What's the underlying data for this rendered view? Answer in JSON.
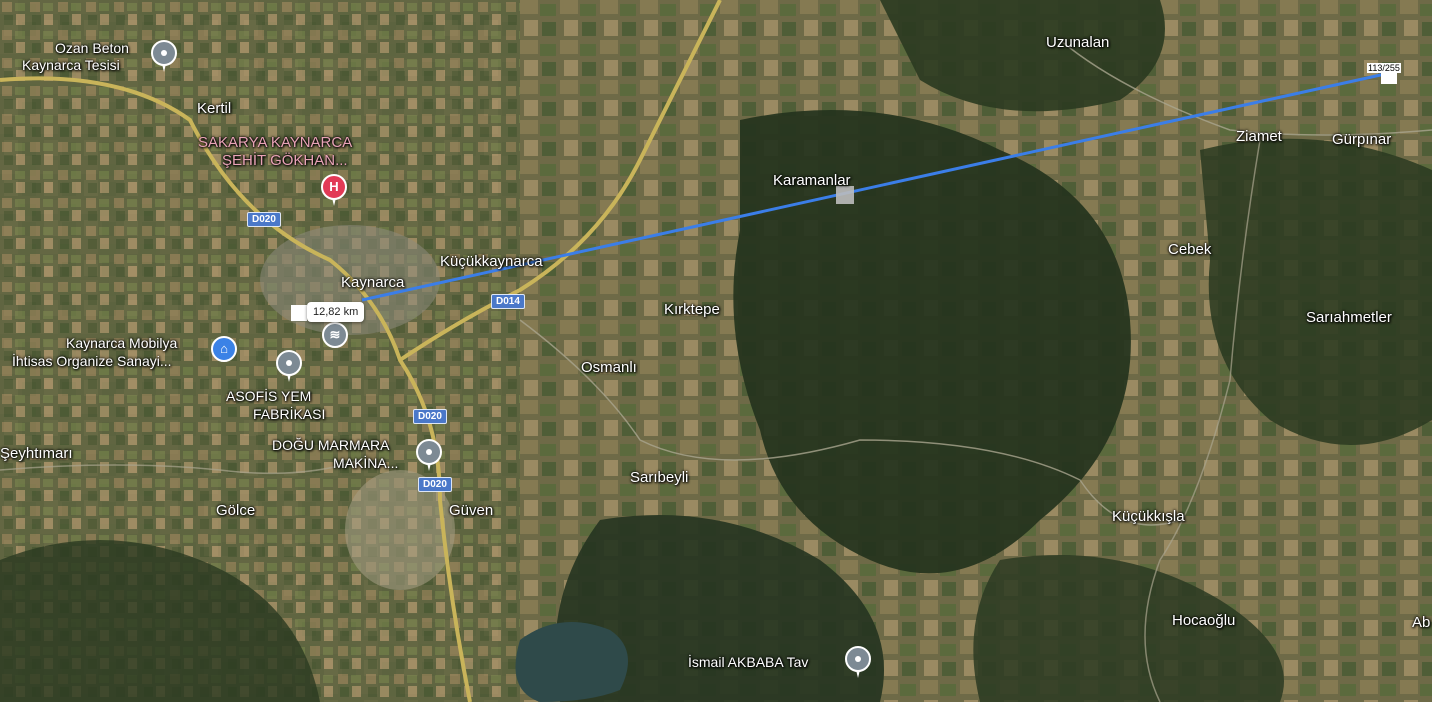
{
  "places": [
    {
      "id": "ozan-beton",
      "text": "Ozan Beton"
    },
    {
      "id": "kaynarca-tesisi",
      "text": "Kaynarca Tesisi"
    },
    {
      "id": "kertil",
      "text": "Kertil"
    },
    {
      "id": "hospital-1",
      "text": "SAKARYA KAYNARCA"
    },
    {
      "id": "hospital-2",
      "text": "ŞEHİT GÖKHAN..."
    },
    {
      "id": "kaynarca",
      "text": "Kaynarca"
    },
    {
      "id": "kucukkaynarca",
      "text": "Küçükkaynarca"
    },
    {
      "id": "mobilya-1",
      "text": "Kaynarca Mobilya"
    },
    {
      "id": "mobilya-2",
      "text": "İhtisas Organize Sanayi..."
    },
    {
      "id": "asofis-1",
      "text": "ASOFİS YEM"
    },
    {
      "id": "asofis-2",
      "text": "FABRİKASI"
    },
    {
      "id": "dogu-1",
      "text": "DOĞU MARMARA"
    },
    {
      "id": "dogu-2",
      "text": "MAKİNA..."
    },
    {
      "id": "seyhtimari",
      "text": "Şeyhtımarı"
    },
    {
      "id": "golce",
      "text": "Gölce"
    },
    {
      "id": "guven",
      "text": "Güven"
    },
    {
      "id": "uzunalan",
      "text": "Uzunalan"
    },
    {
      "id": "ziamet",
      "text": "Ziamet"
    },
    {
      "id": "gurpinar",
      "text": "Gürpınar"
    },
    {
      "id": "karamanlar",
      "text": "Karamanlar"
    },
    {
      "id": "cebek",
      "text": "Cebek"
    },
    {
      "id": "kirktepe",
      "text": "Kırktepe"
    },
    {
      "id": "sariahmetler",
      "text": "Sarıahmetler"
    },
    {
      "id": "osmanli",
      "text": "Osmanlı"
    },
    {
      "id": "saribeyli",
      "text": "Sarıbeyli"
    },
    {
      "id": "kucukkisla",
      "text": "Küçükkışla"
    },
    {
      "id": "hocaoglu",
      "text": "Hocaoğlu"
    },
    {
      "id": "akbaba",
      "text": "İsmail AKBABA Tav"
    },
    {
      "id": "ab",
      "text": "Ab"
    }
  ],
  "roads": [
    "D020",
    "D014",
    "D020",
    "D020"
  ],
  "measurement": {
    "distance_label": "12,82 km",
    "end_label": "113/255",
    "line_color": "#3b7ee8"
  },
  "colors": {
    "forest": "#2c3a22",
    "farmland": "#6b6a45",
    "road_yellow": "#c9b45a",
    "hospital": "#e23a56",
    "poi_blue": "#3b82e6"
  }
}
